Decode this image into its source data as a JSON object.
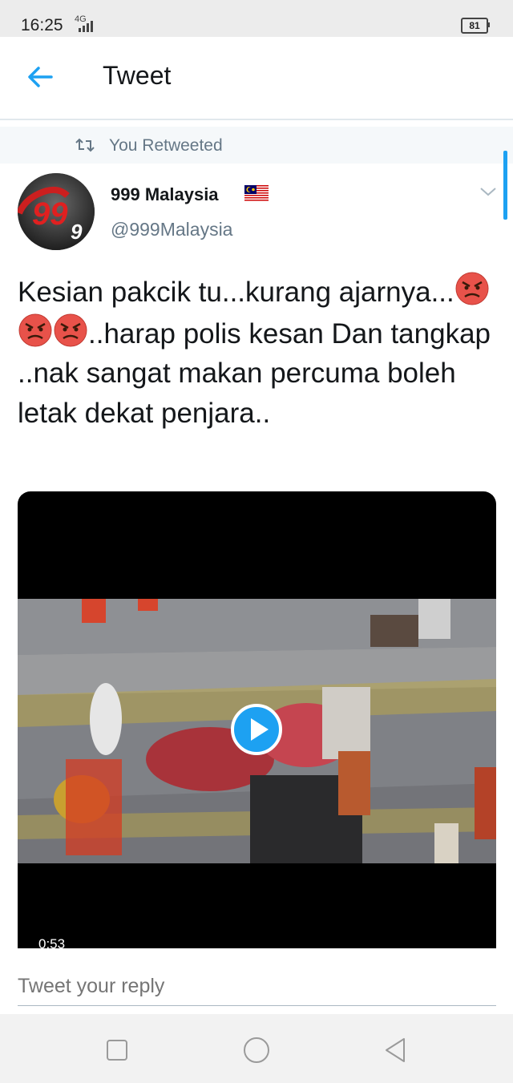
{
  "status_bar": {
    "time": "16:25",
    "network": "4G",
    "battery": "81"
  },
  "header": {
    "title": "Tweet",
    "back_icon": "arrow-left-icon"
  },
  "retweet": {
    "label": "You Retweeted"
  },
  "tweet": {
    "display_name": "999 Malaysia",
    "handle": "@999Malaysia",
    "text_part1": "Kesian pakcik tu...kurang ajarnya...",
    "text_part2": "..harap polis kesan Dan tangkap ..nak sangat makan percuma boleh letak dekat penjara..",
    "emoji": "angry-face-icon"
  },
  "video": {
    "duration": "0:53"
  },
  "reply": {
    "placeholder": "Tweet your reply"
  },
  "colors": {
    "accent": "#1da1f2",
    "text_secondary": "#657786"
  }
}
